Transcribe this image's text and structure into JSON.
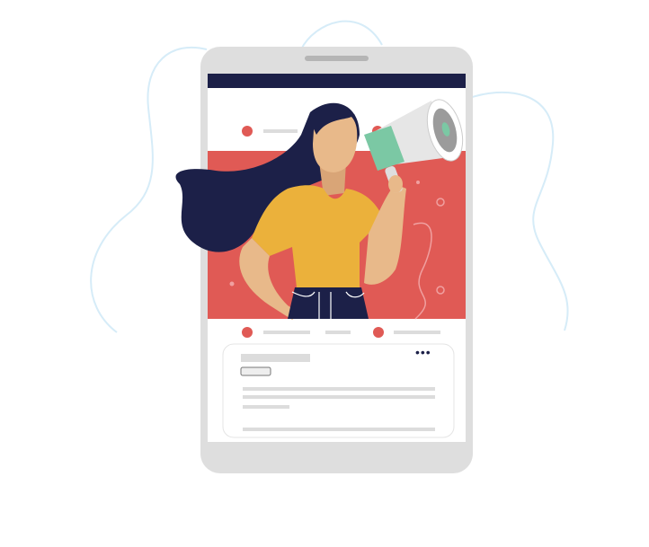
{
  "illustration": {
    "subject": "woman-with-megaphone-social-post",
    "colors": {
      "phone_frame": "#dedede",
      "top_bar": "#1c2048",
      "post_image": "#e05a55",
      "accent_dot": "#e05a55",
      "placeholder_line": "#dcdcdc",
      "hair": "#1c2048",
      "skin": "#e8b98a",
      "shirt": "#ebb13b",
      "pants": "#1c2048",
      "megaphone_green": "#7bc8a4",
      "squiggle": "#d6ecf8"
    },
    "card": {
      "menu_icon": "more-horizontal-icon",
      "menu_glyph": "•••"
    }
  }
}
